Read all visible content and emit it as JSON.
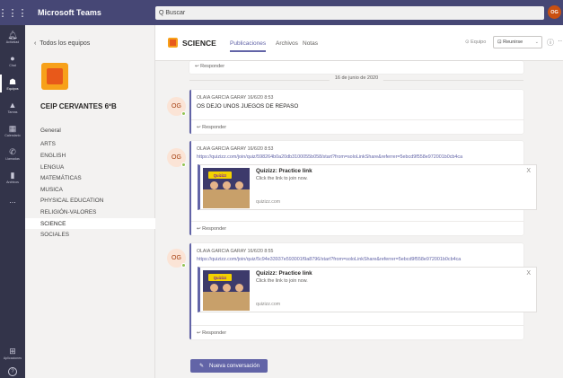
{
  "topbar": {
    "app_title": "Microsoft Teams",
    "search_placeholder": "Buscar",
    "user_initials": "OG"
  },
  "rail": {
    "items": [
      {
        "label": "Actividad",
        "icon": "bell-icon"
      },
      {
        "label": "Chat",
        "icon": "chat-icon"
      },
      {
        "label": "Equipos",
        "icon": "teams-icon",
        "active": true
      },
      {
        "label": "Tareas",
        "icon": "assignments-icon"
      },
      {
        "label": "Calendario",
        "icon": "calendar-icon"
      },
      {
        "label": "Llamadas",
        "icon": "phone-icon"
      },
      {
        "label": "Archivos",
        "icon": "files-icon"
      },
      {
        "label": "...",
        "icon": "more-icon"
      }
    ],
    "apps_label": "Aplicaciones",
    "help_glyph": "?"
  },
  "teams_panel": {
    "back_label": "Todos los equipos",
    "team_name": "CEIP CERVANTES 6ºB",
    "channels": [
      "General",
      "ARTS",
      "ENGLISH",
      "LENGUA",
      "MATEMÁTICAS",
      "MUSICA",
      "PHYSICAL EDUCATION",
      "RELIGIÓN-VALORES",
      "SCIENCE",
      "SOCIALES"
    ],
    "active_channel": "SCIENCE"
  },
  "channel_header": {
    "name": "SCIENCE",
    "tabs": [
      "Publicaciones",
      "Archivos",
      "Notas"
    ],
    "active_tab": "Publicaciones",
    "team_label": "Equipo",
    "meet_label": "Reunirse",
    "info_glyph": "ⓘ",
    "more_glyph": "···"
  },
  "feed": {
    "reply_label": "Responder",
    "date_divider": "16 de junio de 2020",
    "messages": [
      {
        "initials": "OG",
        "meta": "OLAIA GARCIA GARAY  16/6/20 8:53",
        "text": "OS DEJO UNOS JUEGOS DE REPASO"
      },
      {
        "initials": "OG",
        "meta": "OLAIA GARCIA GARAY  16/6/20 8:53",
        "link": "https://quizizz.com/join/quiz/598264b0a20db3100055b058/start?from=soloLinkShare&referrer=5ebcd9f558e972001b0cb4ca",
        "preview": {
          "image_label": "Quizizz",
          "title": "Quizizz: Practice link",
          "desc": "Click the link to join now.",
          "domain": "quizizz.com",
          "close": "X"
        }
      },
      {
        "initials": "OG",
        "meta": "OLAIA GARCIA GARAY  16/6/20 8:55",
        "link": "https://quizizz.com/join/quiz/5c94e33937e593001f9a8796/start?from=soloLinkShare&referrer=5ebcd9f558e972001b0cb4ca",
        "preview": {
          "image_label": "Quizizz",
          "title": "Quizizz: Practice link",
          "desc": "Click the link to join now.",
          "domain": "quizizz.com",
          "close": "X"
        }
      }
    ],
    "new_conversation_label": "Nueva conversación"
  },
  "colors": {
    "brand": "#6264a7",
    "topbar": "#464775",
    "rail": "#33344a",
    "avatar_bg": "#fbe4d6",
    "presence": "#92c353"
  }
}
